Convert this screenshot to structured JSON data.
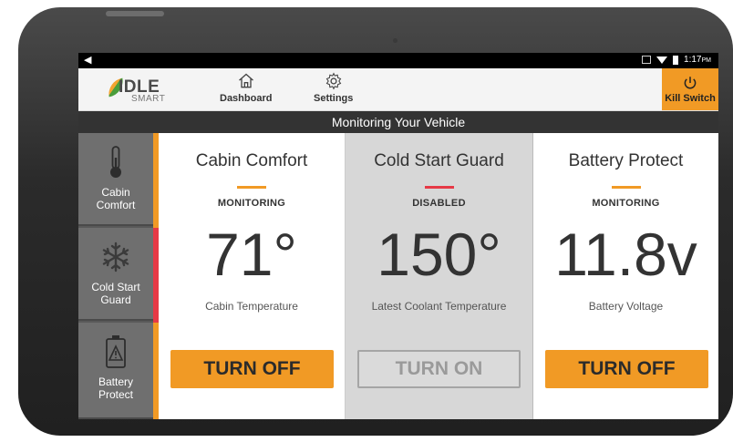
{
  "status_bar": {
    "time": "1:17",
    "ampm": "PM"
  },
  "app": {
    "logo_text": "IDLE",
    "logo_sub": "SMART",
    "nav": [
      {
        "label": "Dashboard",
        "icon": "home-icon"
      },
      {
        "label": "Settings",
        "icon": "gear-icon"
      }
    ],
    "kill_switch": {
      "label": "Kill Switch",
      "icon": "power-icon",
      "color": "#f19a25"
    }
  },
  "banner": {
    "text": "Monitoring Your Vehicle"
  },
  "sidebar": {
    "items": [
      {
        "label_line1": "Cabin",
        "label_line2": "Comfort",
        "icon": "thermometer-icon",
        "indicator_color": "#f19a25"
      },
      {
        "label_line1": "Cold Start",
        "label_line2": "Guard",
        "icon": "snowflake-icon",
        "indicator_color": "#e63946"
      },
      {
        "label_line1": "Battery",
        "label_line2": "Protect",
        "icon": "battery-warning-icon",
        "indicator_color": "#f19a25"
      }
    ]
  },
  "cards": [
    {
      "title": "Cabin Comfort",
      "status": "MONITORING",
      "value": "71°",
      "caption": "Cabin Temperature",
      "button": "TURN OFF",
      "accent": "#f19a25",
      "enabled": true
    },
    {
      "title": "Cold Start Guard",
      "status": "DISABLED",
      "value": "150°",
      "caption": "Latest Coolant Temperature",
      "button": "TURN ON",
      "accent": "#e63946",
      "enabled": false
    },
    {
      "title": "Battery Protect",
      "status": "MONITORING",
      "value": "11.8v",
      "caption": "Battery Voltage",
      "button": "TURN OFF",
      "accent": "#f19a25",
      "enabled": true
    }
  ]
}
